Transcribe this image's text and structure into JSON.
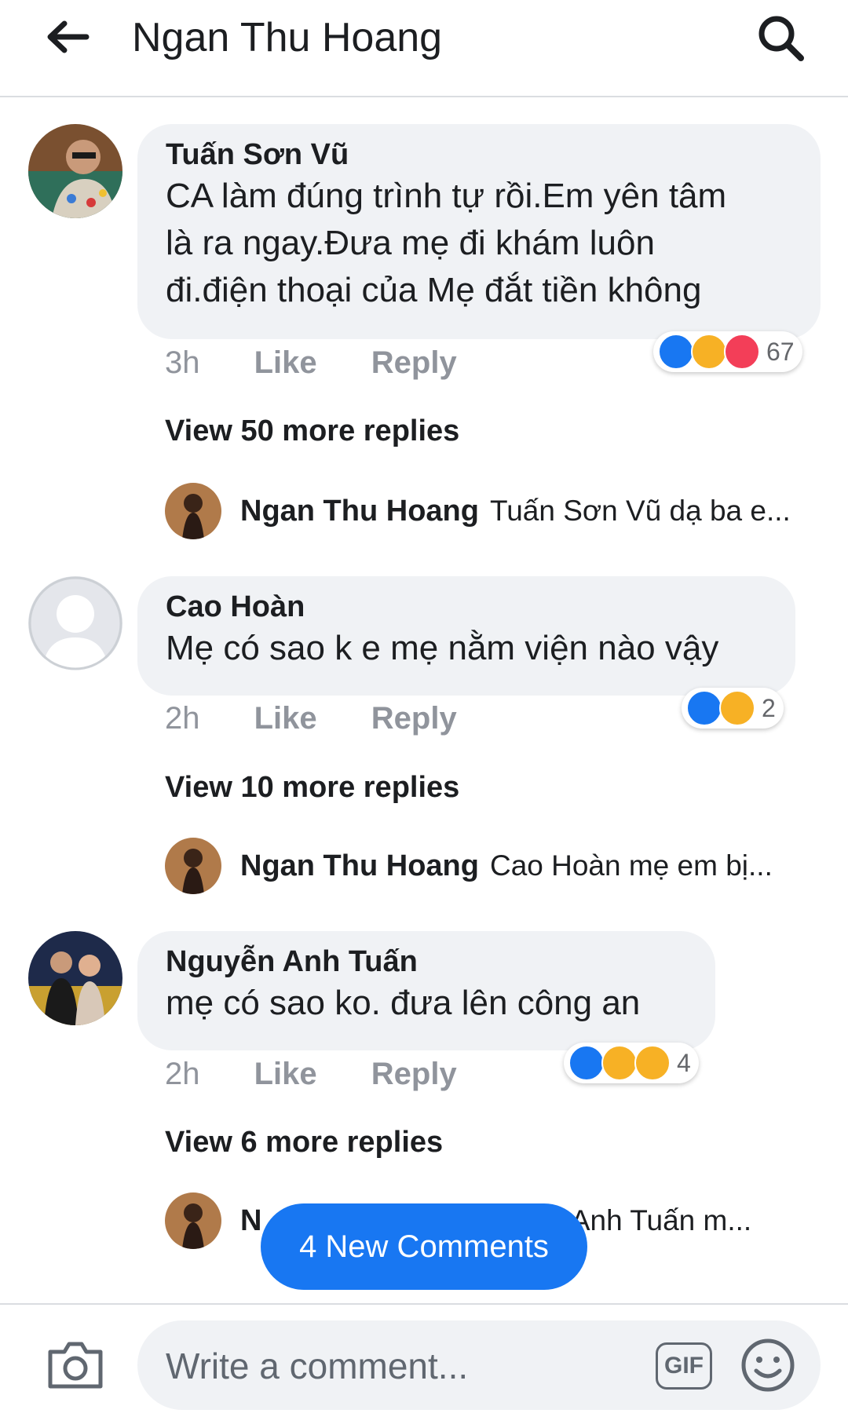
{
  "header": {
    "title": "Ngan Thu Hoang"
  },
  "comments": [
    {
      "author": "Tuấn Sơn Vũ",
      "lines": [
        "CA làm đúng trình tự rồi.Em yên tâm",
        "là ra ngay.Đưa mẹ đi khám luôn",
        "đi.điện thoại của Mẹ đắt tiền không"
      ],
      "time": "3h",
      "like": "Like",
      "reply": "Reply",
      "reactions": [
        "like",
        "haha",
        "love"
      ],
      "reaction_count": "67",
      "view_more": "View 50 more replies",
      "reply_preview": {
        "author": "Ngan Thu Hoang",
        "text": "Tuấn Sơn Vũ  dạ ba e..."
      }
    },
    {
      "author": "Cao Hoàn",
      "lines": [
        "Mẹ có sao k e mẹ nằm viện nào vậy"
      ],
      "time": "2h",
      "like": "Like",
      "reply": "Reply",
      "reactions": [
        "like",
        "sad"
      ],
      "reaction_count": "2",
      "view_more": "View 10 more replies",
      "reply_preview": {
        "author": "Ngan Thu Hoang",
        "text": "Cao Hoàn mẹ em bị..."
      }
    },
    {
      "author": "Nguyễn Anh Tuấn",
      "lines": [
        "mẹ có sao ko. đưa lên công an"
      ],
      "time": "2h",
      "like": "Like",
      "reply": "Reply",
      "reactions": [
        "like",
        "haha",
        "sad"
      ],
      "reaction_count": "4",
      "view_more": "View 6 more replies",
      "reply_preview": {
        "author": "N",
        "text": "ễn Anh Tuấn m..."
      }
    }
  ],
  "new_comments_button": "4 New Comments",
  "composer": {
    "placeholder": "Write a comment...",
    "gif_label": "GIF"
  },
  "colors": {
    "accent": "#1877f2",
    "bubble": "#f0f2f5",
    "muted": "#90949c"
  }
}
